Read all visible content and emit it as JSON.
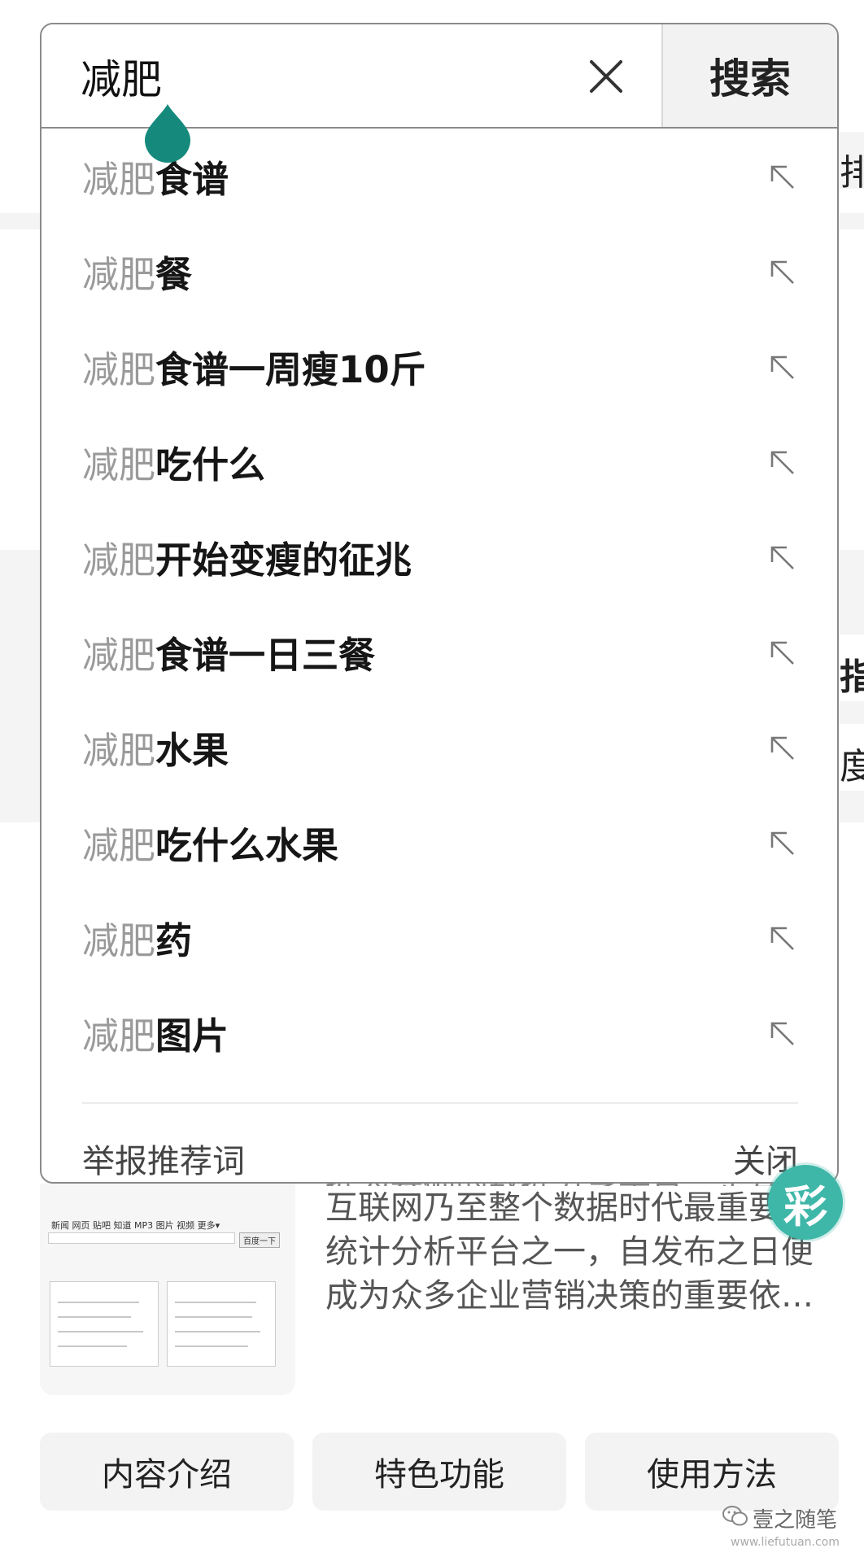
{
  "search": {
    "query": "减肥",
    "button_label": "搜索"
  },
  "suggestions": [
    {
      "prefix": "减肥",
      "rest": "食谱"
    },
    {
      "prefix": "减肥",
      "rest": "餐"
    },
    {
      "prefix": "减肥",
      "rest": "食谱一周瘦10斤"
    },
    {
      "prefix": "减肥",
      "rest": "吃什么"
    },
    {
      "prefix": "减肥",
      "rest": "开始变瘦的征兆"
    },
    {
      "prefix": "减肥",
      "rest": "食谱一日三餐"
    },
    {
      "prefix": "减肥",
      "rest": "水果"
    },
    {
      "prefix": "减肥",
      "rest": "吃什么水果"
    },
    {
      "prefix": "减肥",
      "rest": "药"
    },
    {
      "prefix": "减肥",
      "rest": "图片"
    }
  ],
  "dropdown_footer": {
    "report_label": "举报推荐词",
    "close_label": "关闭"
  },
  "background": {
    "edge_texts": [
      "排",
      "指",
      "度"
    ],
    "badge": "彩",
    "article_lines": [
      "互联网乃至整个数据时代最重要的",
      "统计分析平台之一，自发布之日便",
      "成为众多企业营销决策的重要依…"
    ],
    "article_cut_line": "据为基础的数据分享平台，是互的",
    "thumb_nav": "新闻  网页  贴吧  知道  MP3  图片  视频  更多▾",
    "thumb_button": "百度一下",
    "tabs": [
      "内容介绍",
      "特色功能",
      "使用方法"
    ]
  },
  "watermark": {
    "name": "壹之随笔",
    "url": "www.liefutuan.com"
  },
  "colors": {
    "cursor_handle": "#158a7c",
    "badge": "#3fb7a8",
    "border": "#8a8a8a"
  }
}
